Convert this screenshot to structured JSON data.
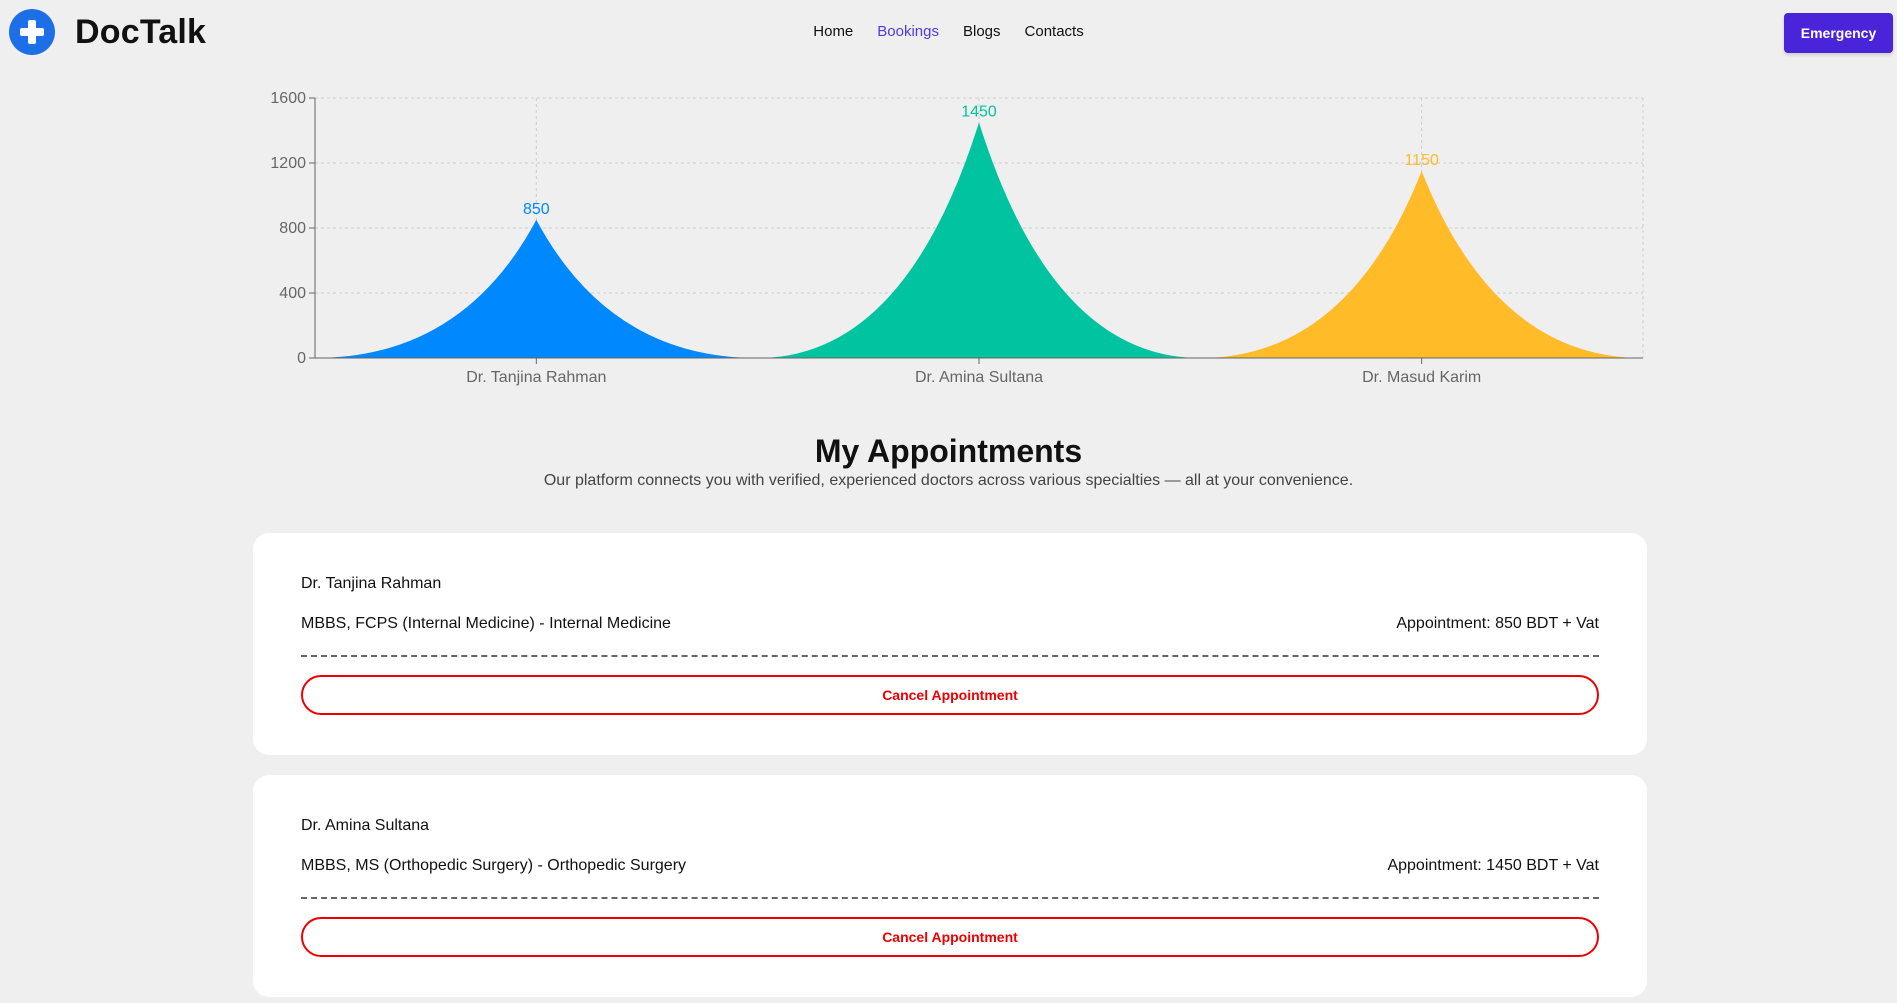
{
  "brand": {
    "name": "DocTalk",
    "icon": "plus-circle-icon"
  },
  "nav": {
    "items": [
      {
        "label": "Home",
        "active": false
      },
      {
        "label": "Bookings",
        "active": true
      },
      {
        "label": "Blogs",
        "active": false
      },
      {
        "label": "Contacts",
        "active": false
      }
    ],
    "emergency_label": "Emergency"
  },
  "colors": {
    "brand": "#1d6fe8",
    "accent": "#4a24d9",
    "active_link": "#4f3ce0",
    "danger": "#e00000"
  },
  "chart_data": {
    "type": "area",
    "title": "",
    "xlabel": "",
    "ylabel": "",
    "categories": [
      "Dr. Tanjina Rahman",
      "Dr. Amina Sultana",
      "Dr. Masud Karim"
    ],
    "values": [
      850,
      1450,
      1150
    ],
    "colors": [
      "#0088fe",
      "#00c49f",
      "#ffbb28"
    ],
    "ylim": [
      0,
      1600
    ],
    "yticks": [
      0,
      400,
      800,
      1200,
      1600
    ],
    "grid": true,
    "shape": "triangle-peaks"
  },
  "appointments_section": {
    "title": "My Appointments",
    "subtitle": "Our platform connects you with verified, experienced doctors across various specialties — all at your convenience."
  },
  "appointments": [
    {
      "name": "Dr. Tanjina Rahman",
      "qualification": "MBBS, FCPS (Internal Medicine) - Internal Medicine",
      "fee": "Appointment: 850 BDT + Vat",
      "cancel_label": "Cancel Appointment"
    },
    {
      "name": "Dr. Amina Sultana",
      "qualification": "MBBS, MS (Orthopedic Surgery) - Orthopedic Surgery",
      "fee": "Appointment: 1450 BDT + Vat",
      "cancel_label": "Cancel Appointment"
    }
  ]
}
